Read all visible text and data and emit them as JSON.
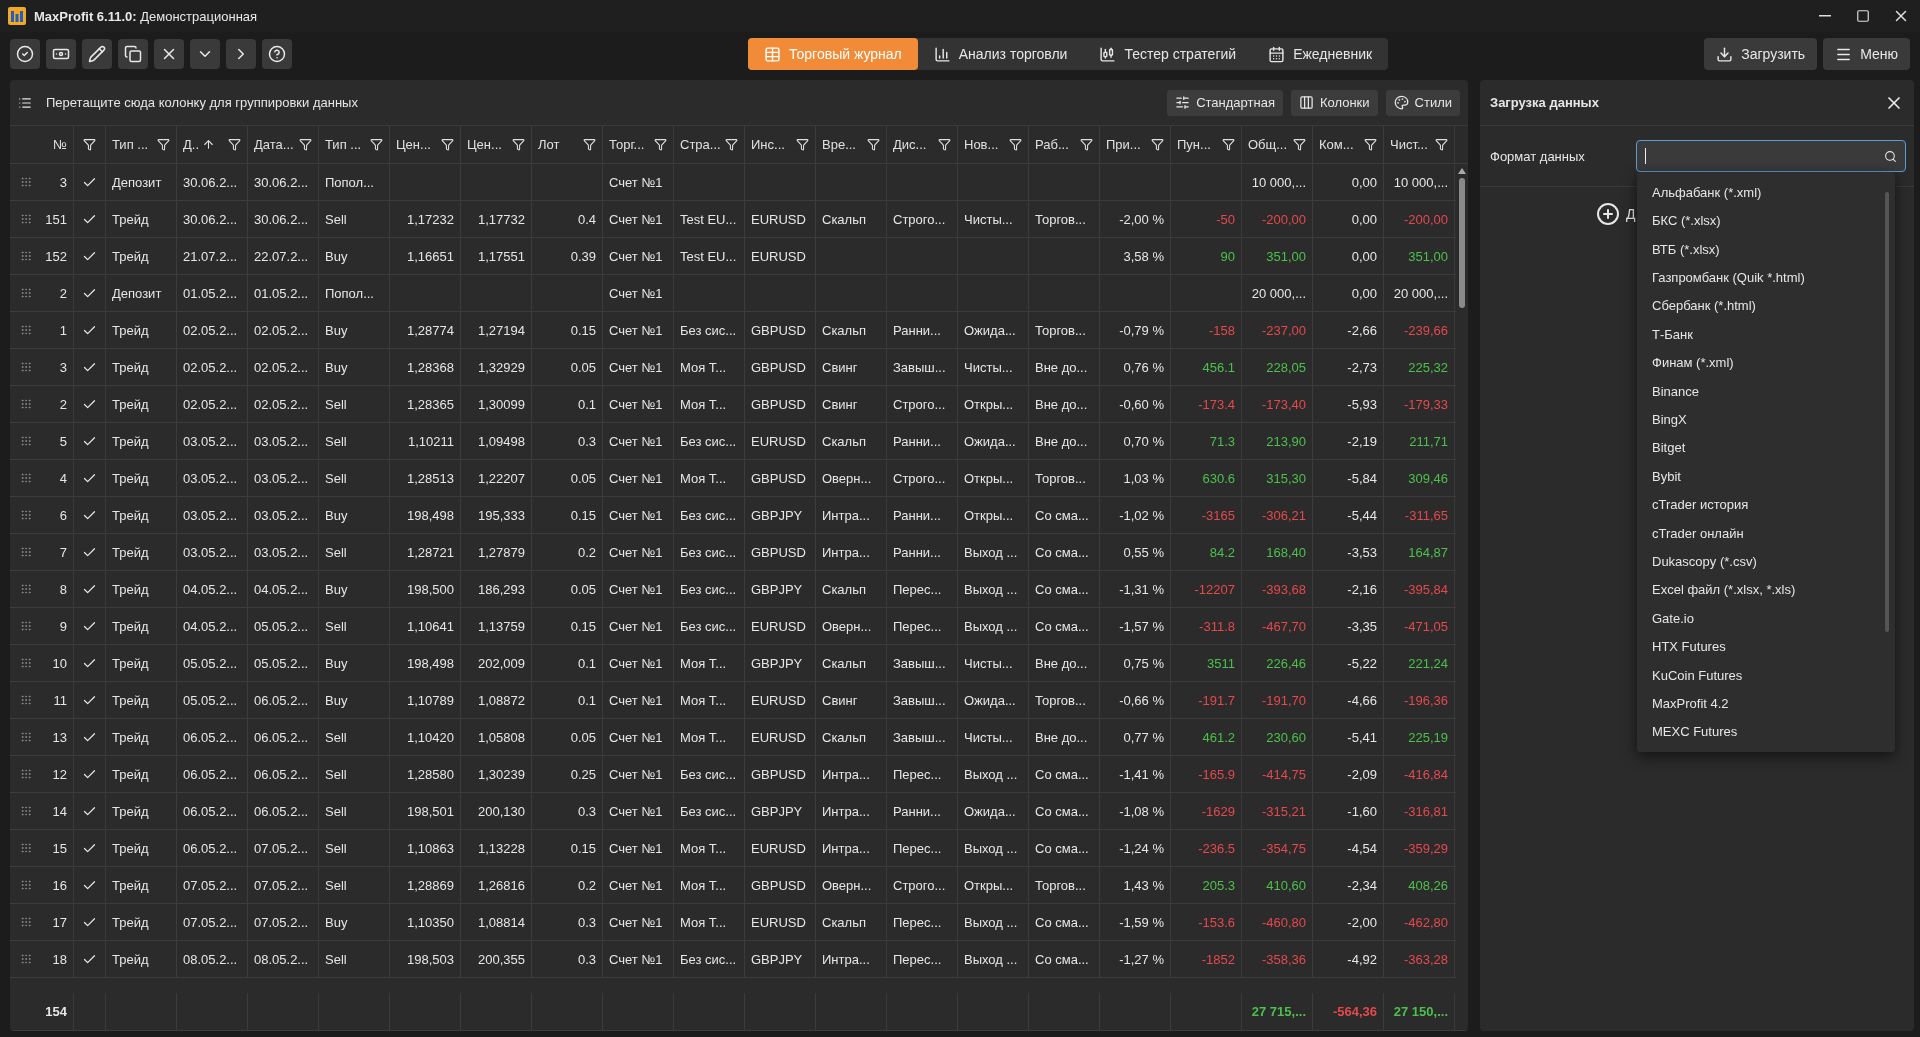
{
  "window": {
    "title": "**MaxProfit 6.11.0:** Демонстрационная"
  },
  "tabs": [
    {
      "label": "Торговый журнал",
      "selected": true
    },
    {
      "label": "Анализ торговли",
      "selected": false
    },
    {
      "label": "Тестер стратегий",
      "selected": false
    },
    {
      "label": "Ежедневник",
      "selected": false
    }
  ],
  "actions": [
    "Загрузить",
    "Меню"
  ],
  "group_bar": {
    "hint": "Перетащите сюда колонку для группировки данных",
    "buttons": [
      "Стандартная",
      "Колонки",
      "Стили"
    ]
  },
  "table": {
    "number_column": {
      "label": "№"
    },
    "check_column": {
      "filter": true
    },
    "columns": [
      {
        "label": "Тип ...",
        "kind": "text",
        "filter": true
      },
      {
        "label": "Д..",
        "kind": "text",
        "filter": true,
        "sorted_ascending": true
      },
      {
        "label": "Дата...",
        "kind": "text",
        "filter": true
      },
      {
        "label": "Тип ...",
        "kind": "text",
        "filter": true
      },
      {
        "label": "Цен...",
        "kind": "number",
        "filter": true
      },
      {
        "label": "Цен...",
        "kind": "number",
        "filter": true
      },
      {
        "label": "Лот",
        "kind": "number",
        "filter": true
      },
      {
        "label": "Торг...",
        "kind": "text",
        "filter": true
      },
      {
        "label": "Стра...",
        "kind": "text",
        "filter": true
      },
      {
        "label": "Инс...",
        "kind": "text",
        "filter": true
      },
      {
        "label": "Вре...",
        "kind": "text",
        "filter": true
      },
      {
        "label": "Дис...",
        "kind": "text",
        "filter": true
      },
      {
        "label": "Нов...",
        "kind": "text",
        "filter": true
      },
      {
        "label": "Раб...",
        "kind": "text",
        "filter": true
      },
      {
        "label": "При...",
        "kind": "number",
        "filter": true
      },
      {
        "label": "Пун...",
        "kind": "number",
        "filter": true
      },
      {
        "label": "Общ...",
        "kind": "number",
        "filter": true
      },
      {
        "label": "Ком...",
        "kind": "number",
        "filter": true
      },
      {
        "label": "Чист...",
        "kind": "number",
        "filter": true
      }
    ],
    "rows": [
      {
        "no": "3",
        "checked": true,
        "cells": [
          "Депозит",
          "30.06.2...",
          "30.06.2...",
          "Попол...",
          null,
          null,
          null,
          "Счет №1",
          null,
          null,
          null,
          null,
          null,
          null,
          null,
          null,
          "10 000,...",
          "0,00",
          "10 000,..."
        ]
      },
      {
        "no": "151",
        "checked": true,
        "cells": [
          "Трейд",
          "30.06.2...",
          "30.06.2...",
          "Sell",
          "1,17232",
          "1,17732",
          "0.4",
          "Счет №1",
          "Test EU...",
          "EURUSD",
          "Скальп",
          "Строго...",
          "Чисты...",
          "Торгов...",
          "-2,00 %",
          {
            "text": "-50",
            "color": "#e5484d"
          },
          {
            "text": "-200,00",
            "color": "#e5484d"
          },
          "0,00",
          {
            "text": "-200,00",
            "color": "#e5484d"
          }
        ]
      },
      {
        "no": "152",
        "checked": true,
        "cells": [
          "Трейд",
          "21.07.2...",
          "22.07.2...",
          "Buy",
          "1,16651",
          "1,17551",
          "0.39",
          "Счет №1",
          "Test EU...",
          "EURUSD",
          null,
          null,
          null,
          null,
          "3,58 %",
          {
            "text": "90",
            "color": "#4cc04c"
          },
          {
            "text": "351,00",
            "color": "#4cc04c"
          },
          "0,00",
          {
            "text": "351,00",
            "color": "#4cc04c"
          }
        ]
      },
      {
        "no": "2",
        "checked": true,
        "cells": [
          "Депозит",
          "01.05.2...",
          "01.05.2...",
          "Попол...",
          null,
          null,
          null,
          "Счет №1",
          null,
          null,
          null,
          null,
          null,
          null,
          null,
          null,
          "20 000,...",
          "0,00",
          "20 000,..."
        ]
      },
      {
        "no": "1",
        "checked": true,
        "cells": [
          "Трейд",
          "02.05.2...",
          "02.05.2...",
          "Buy",
          "1,28774",
          "1,27194",
          "0.15",
          "Счет №1",
          "Без сис...",
          "GBPUSD",
          "Скальп",
          "Ранни...",
          "Ожида...",
          "Торгов...",
          "-0,79 %",
          {
            "text": "-158",
            "color": "#e5484d"
          },
          {
            "text": "-237,00",
            "color": "#e5484d"
          },
          "-2,66",
          {
            "text": "-239,66",
            "color": "#e5484d"
          }
        ]
      },
      {
        "no": "3",
        "checked": true,
        "cells": [
          "Трейд",
          "02.05.2...",
          "02.05.2...",
          "Buy",
          "1,28368",
          "1,32929",
          "0.05",
          "Счет №1",
          "Моя Т...",
          "GBPUSD",
          "Свинг",
          "Завыш...",
          "Чисты...",
          "Вне до...",
          "0,76 %",
          {
            "text": "456.1",
            "color": "#4cc04c"
          },
          {
            "text": "228,05",
            "color": "#4cc04c"
          },
          "-2,73",
          {
            "text": "225,32",
            "color": "#4cc04c"
          }
        ]
      },
      {
        "no": "2",
        "checked": true,
        "cells": [
          "Трейд",
          "02.05.2...",
          "02.05.2...",
          "Sell",
          "1,28365",
          "1,30099",
          "0.1",
          "Счет №1",
          "Моя Т...",
          "GBPUSD",
          "Свинг",
          "Строго...",
          "Откры...",
          "Вне до...",
          "-0,60 %",
          {
            "text": "-173.4",
            "color": "#e5484d"
          },
          {
            "text": "-173,40",
            "color": "#e5484d"
          },
          "-5,93",
          {
            "text": "-179,33",
            "color": "#e5484d"
          }
        ]
      },
      {
        "no": "5",
        "checked": true,
        "cells": [
          "Трейд",
          "03.05.2...",
          "03.05.2...",
          "Sell",
          "1,10211",
          "1,09498",
          "0.3",
          "Счет №1",
          "Без сис...",
          "EURUSD",
          "Скальп",
          "Ранни...",
          "Ожида...",
          "Вне до...",
          "0,70 %",
          {
            "text": "71.3",
            "color": "#4cc04c"
          },
          {
            "text": "213,90",
            "color": "#4cc04c"
          },
          "-2,19",
          {
            "text": "211,71",
            "color": "#4cc04c"
          }
        ]
      },
      {
        "no": "4",
        "checked": true,
        "cells": [
          "Трейд",
          "03.05.2...",
          "03.05.2...",
          "Sell",
          "1,28513",
          "1,22207",
          "0.05",
          "Счет №1",
          "Моя Т...",
          "GBPUSD",
          "Оверн...",
          "Строго...",
          "Откры...",
          "Торгов...",
          "1,03 %",
          {
            "text": "630.6",
            "color": "#4cc04c"
          },
          {
            "text": "315,30",
            "color": "#4cc04c"
          },
          "-5,84",
          {
            "text": "309,46",
            "color": "#4cc04c"
          }
        ]
      },
      {
        "no": "6",
        "checked": true,
        "cells": [
          "Трейд",
          "03.05.2...",
          "03.05.2...",
          "Buy",
          "198,498",
          "195,333",
          "0.15",
          "Счет №1",
          "Без сис...",
          "GBPJPY",
          "Интра...",
          "Ранни...",
          "Откры...",
          "Со сма...",
          "-1,02 %",
          {
            "text": "-3165",
            "color": "#e5484d"
          },
          {
            "text": "-306,21",
            "color": "#e5484d"
          },
          "-5,44",
          {
            "text": "-311,65",
            "color": "#e5484d"
          }
        ]
      },
      {
        "no": "7",
        "checked": true,
        "cells": [
          "Трейд",
          "03.05.2...",
          "03.05.2...",
          "Sell",
          "1,28721",
          "1,27879",
          "0.2",
          "Счет №1",
          "Без сис...",
          "GBPUSD",
          "Интра...",
          "Ранни...",
          "Выход ...",
          "Со сма...",
          "0,55 %",
          {
            "text": "84.2",
            "color": "#4cc04c"
          },
          {
            "text": "168,40",
            "color": "#4cc04c"
          },
          "-3,53",
          {
            "text": "164,87",
            "color": "#4cc04c"
          }
        ]
      },
      {
        "no": "8",
        "checked": true,
        "cells": [
          "Трейд",
          "04.05.2...",
          "04.05.2...",
          "Buy",
          "198,500",
          "186,293",
          "0.05",
          "Счет №1",
          "Без сис...",
          "GBPJPY",
          "Скальп",
          "Перес...",
          "Выход ...",
          "Со сма...",
          "-1,31 %",
          {
            "text": "-12207",
            "color": "#e5484d"
          },
          {
            "text": "-393,68",
            "color": "#e5484d"
          },
          "-2,16",
          {
            "text": "-395,84",
            "color": "#e5484d"
          }
        ]
      },
      {
        "no": "9",
        "checked": true,
        "cells": [
          "Трейд",
          "04.05.2...",
          "05.05.2...",
          "Sell",
          "1,10641",
          "1,13759",
          "0.15",
          "Счет №1",
          "Без сис...",
          "EURUSD",
          "Оверн...",
          "Перес...",
          "Выход ...",
          "Со сма...",
          "-1,57 %",
          {
            "text": "-311.8",
            "color": "#e5484d"
          },
          {
            "text": "-467,70",
            "color": "#e5484d"
          },
          "-3,35",
          {
            "text": "-471,05",
            "color": "#e5484d"
          }
        ]
      },
      {
        "no": "10",
        "checked": true,
        "cells": [
          "Трейд",
          "05.05.2...",
          "05.05.2...",
          "Buy",
          "198,498",
          "202,009",
          "0.1",
          "Счет №1",
          "Моя Т...",
          "GBPJPY",
          "Скальп",
          "Завыш...",
          "Чисты...",
          "Вне до...",
          "0,75 %",
          {
            "text": "3511",
            "color": "#4cc04c"
          },
          {
            "text": "226,46",
            "color": "#4cc04c"
          },
          "-5,22",
          {
            "text": "221,24",
            "color": "#4cc04c"
          }
        ]
      },
      {
        "no": "11",
        "checked": true,
        "cells": [
          "Трейд",
          "05.05.2...",
          "06.05.2...",
          "Buy",
          "1,10789",
          "1,08872",
          "0.1",
          "Счет №1",
          "Моя Т...",
          "EURUSD",
          "Свинг",
          "Завыш...",
          "Ожида...",
          "Торгов...",
          "-0,66 %",
          {
            "text": "-191.7",
            "color": "#e5484d"
          },
          {
            "text": "-191,70",
            "color": "#e5484d"
          },
          "-4,66",
          {
            "text": "-196,36",
            "color": "#e5484d"
          }
        ]
      },
      {
        "no": "13",
        "checked": true,
        "cells": [
          "Трейд",
          "06.05.2...",
          "06.05.2...",
          "Sell",
          "1,10420",
          "1,05808",
          "0.05",
          "Счет №1",
          "Моя Т...",
          "EURUSD",
          "Скальп",
          "Завыш...",
          "Чисты...",
          "Вне до...",
          "0,77 %",
          {
            "text": "461.2",
            "color": "#4cc04c"
          },
          {
            "text": "230,60",
            "color": "#4cc04c"
          },
          "-5,41",
          {
            "text": "225,19",
            "color": "#4cc04c"
          }
        ]
      },
      {
        "no": "12",
        "checked": true,
        "cells": [
          "Трейд",
          "06.05.2...",
          "06.05.2...",
          "Sell",
          "1,28580",
          "1,30239",
          "0.25",
          "Счет №1",
          "Без сис...",
          "GBPUSD",
          "Интра...",
          "Перес...",
          "Выход ...",
          "Со сма...",
          "-1,41 %",
          {
            "text": "-165.9",
            "color": "#e5484d"
          },
          {
            "text": "-414,75",
            "color": "#e5484d"
          },
          "-2,09",
          {
            "text": "-416,84",
            "color": "#e5484d"
          }
        ]
      },
      {
        "no": "14",
        "checked": true,
        "cells": [
          "Трейд",
          "06.05.2...",
          "06.05.2...",
          "Sell",
          "198,501",
          "200,130",
          "0.3",
          "Счет №1",
          "Без сис...",
          "GBPJPY",
          "Интра...",
          "Ранни...",
          "Ожида...",
          "Со сма...",
          "-1,08 %",
          {
            "text": "-1629",
            "color": "#e5484d"
          },
          {
            "text": "-315,21",
            "color": "#e5484d"
          },
          "-1,60",
          {
            "text": "-316,81",
            "color": "#e5484d"
          }
        ]
      },
      {
        "no": "15",
        "checked": true,
        "cells": [
          "Трейд",
          "06.05.2...",
          "07.05.2...",
          "Sell",
          "1,10863",
          "1,13228",
          "0.15",
          "Счет №1",
          "Моя Т...",
          "EURUSD",
          "Интра...",
          "Перес...",
          "Выход ...",
          "Со сма...",
          "-1,24 %",
          {
            "text": "-236.5",
            "color": "#e5484d"
          },
          {
            "text": "-354,75",
            "color": "#e5484d"
          },
          "-4,54",
          {
            "text": "-359,29",
            "color": "#e5484d"
          }
        ]
      },
      {
        "no": "16",
        "checked": true,
        "cells": [
          "Трейд",
          "07.05.2...",
          "07.05.2...",
          "Sell",
          "1,28869",
          "1,26816",
          "0.2",
          "Счет №1",
          "Моя Т...",
          "GBPUSD",
          "Оверн...",
          "Строго...",
          "Откры...",
          "Торгов...",
          "1,43 %",
          {
            "text": "205.3",
            "color": "#4cc04c"
          },
          {
            "text": "410,60",
            "color": "#4cc04c"
          },
          "-2,34",
          {
            "text": "408,26",
            "color": "#4cc04c"
          }
        ]
      },
      {
        "no": "17",
        "checked": true,
        "cells": [
          "Трейд",
          "07.05.2...",
          "07.05.2...",
          "Buy",
          "1,10350",
          "1,08814",
          "0.3",
          "Счет №1",
          "Моя Т...",
          "EURUSD",
          "Скальп",
          "Перес...",
          "Выход ...",
          "Со сма...",
          "-1,59 %",
          {
            "text": "-153.6",
            "color": "#e5484d"
          },
          {
            "text": "-460,80",
            "color": "#e5484d"
          },
          "-2,00",
          {
            "text": "-462,80",
            "color": "#e5484d"
          }
        ]
      },
      {
        "no": "18",
        "checked": true,
        "cells": [
          "Трейд",
          "08.05.2...",
          "08.05.2...",
          "Sell",
          "198,503",
          "200,355",
          "0.3",
          "Счет №1",
          "Без сис...",
          "GBPJPY",
          "Интра...",
          "Перес...",
          "Выход ...",
          "Со сма...",
          "-1,27 %",
          {
            "text": "-1852",
            "color": "#e5484d"
          },
          {
            "text": "-358,36",
            "color": "#e5484d"
          },
          "-4,92",
          {
            "text": "-363,28",
            "color": "#e5484d"
          }
        ]
      }
    ],
    "footer": {
      "count": "154",
      "cells": [
        null,
        null,
        null,
        null,
        null,
        null,
        null,
        null,
        null,
        null,
        null,
        null,
        null,
        null,
        null,
        null,
        {
          "text": "27 715,...",
          "color": "#4cc04c"
        },
        {
          "text": "-564,36",
          "color": "#e5484d"
        },
        {
          "text": "27 150,...",
          "color": "#4cc04c"
        }
      ]
    }
  },
  "load_panel": {
    "title": "Загрузка данных",
    "field_label": "Формат данных",
    "add_label": "Д",
    "formats": [
      "Альфабанк (*.xml)",
      "БКС (*.xlsx)",
      "ВТБ (*.xlsx)",
      "Газпромбанк (Quik *.html)",
      "Сбербанк (*.html)",
      "Т-Банк",
      "Финам (*.xml)",
      "Binance",
      "BingX",
      "Bitget",
      "Bybit",
      "cTrader история",
      "cTrader онлайн",
      "Dukascopy (*.csv)",
      "Excel файл (*.xlsx, *.xls)",
      "Gate.io",
      "HTX Futures",
      "KuCoin Futures",
      "MaxProfit 4.2",
      "MEXC Futures"
    ]
  }
}
